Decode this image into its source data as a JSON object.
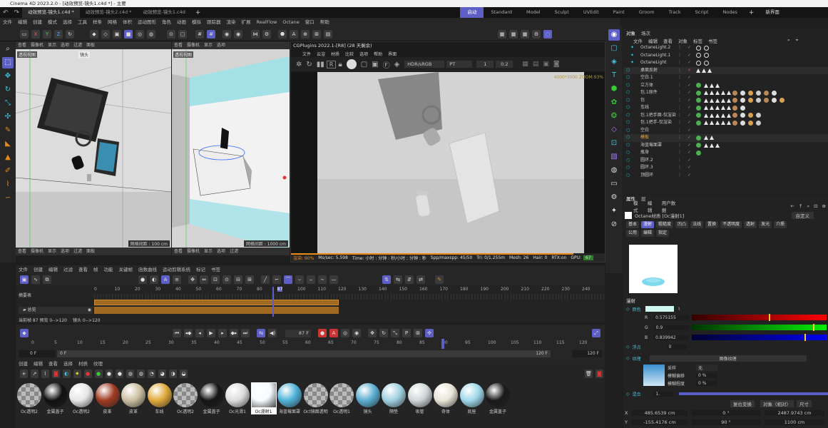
{
  "window": {
    "title": "Cinema 4D 2023.2.0 - [动效预览-镜头1.c4d *] - 主要"
  },
  "doc_tabs": [
    "动效预览-镜头1.c4d *",
    "动效预览-镜头2.c4d *",
    "动效预览-镜头1.c4d"
  ],
  "layouts": [
    "启动",
    "Standard",
    "Model",
    "Sculpt",
    "UVEdit",
    "Paint",
    "Groom",
    "Track",
    "Script",
    "Nodes"
  ],
  "new_layout": "新界面",
  "menu": [
    "文件",
    "编辑",
    "创建",
    "模式",
    "选择",
    "工具",
    "样条",
    "网格",
    "体积",
    "运动图形",
    "角色",
    "动画",
    "模拟",
    "跟踪器",
    "渲染",
    "扩展",
    "RealFlow",
    "Octane",
    "窗口",
    "帮助"
  ],
  "viewports": {
    "menu": [
      "查看",
      "摄像机",
      "显示",
      "选项",
      "过滤",
      "面板"
    ],
    "vp1": {
      "label": "透视视图",
      "camera": "镜头",
      "grid": "网格间距 : 100 cm"
    },
    "vp2": {
      "label": "透视视图",
      "grid": "网格间距 : 1000 cm"
    }
  },
  "octane": {
    "title": "CGPlugins  2022.1-[R8] (28 天剩余)",
    "menu": [
      "文件",
      "云渲",
      "材质",
      "比较",
      "选项",
      "帮助",
      "界面"
    ],
    "colorspace": "HDR/sRGB",
    "mode": "PT",
    "val1": "1",
    "val2": "0.2",
    "resolution": "4000*3000 ZOOM:93%",
    "status": {
      "progress": "渲染: 90%",
      "mssec": "Ms/sec: 5.598",
      "time": "Time: 小时 : 分钟 : 秒/小时 : 分钟 : 秒",
      "spp": "Spp/maxspp: 45/50",
      "tri": "Tri: 0/1.255m",
      "mesh": "Mesh: 26",
      "hair": "Hair: 0",
      "rtx": "RTX:on",
      "gpu": "GPU:",
      "gpuval": "67"
    },
    "progress": 0.9
  },
  "timeline": {
    "menu": [
      "文件",
      "创建",
      "编辑",
      "过滤",
      "查看",
      "帧",
      "功能",
      "关键帧",
      "函数曲线",
      "运动剪辑系统",
      "标记",
      "书签"
    ],
    "ticks": [
      "0",
      "10",
      "20",
      "30",
      "40",
      "50",
      "60",
      "70",
      "80",
      "87",
      "100",
      "110",
      "120",
      "130",
      "140",
      "150",
      "160",
      "170",
      "180",
      "190",
      "200",
      "210",
      "220",
      "230",
      "240"
    ],
    "summary": "摘要表",
    "track": "总览",
    "current": "当前帧  87  预览  0-->120",
    "current2": "镜头  0-->120"
  },
  "transport": {
    "frame": "87 F",
    "start": "0 F",
    "startb": "0 F",
    "end": "120 F",
    "endb": "120 F",
    "ticks": [
      "0",
      "5",
      "10",
      "15",
      "20",
      "25",
      "30",
      "35",
      "40",
      "45",
      "50",
      "55",
      "60",
      "65",
      "70",
      "75",
      "80",
      "85",
      "90",
      "95",
      "100",
      "105",
      "110",
      "115",
      "120"
    ]
  },
  "materials": {
    "menu": [
      "创建",
      "编辑",
      "查看",
      "选择",
      "材质",
      "纹理"
    ],
    "items": [
      {
        "name": "Oc透明2",
        "c": "check"
      },
      {
        "name": "金属盖子",
        "c": "#111"
      },
      {
        "name": "Oc透明2",
        "c": "#e6e6e6"
      },
      {
        "name": "皮革",
        "c": "#9e3a22"
      },
      {
        "name": "皮革",
        "c": "#cbbfa0"
      },
      {
        "name": "车线",
        "c": "#e0a93a"
      },
      {
        "name": "Oc透明2",
        "c": "check"
      },
      {
        "name": "金属盖子",
        "c": "#151515"
      },
      {
        "name": "Oc光滑1",
        "c": "#dcdcdc"
      },
      {
        "name": "Oc漫射1",
        "c": "#f4fbff"
      },
      {
        "name": "海蓝莓面罩",
        "c": "#4fb2d8"
      },
      {
        "name": "Oct镜面透明",
        "c": "check"
      },
      {
        "name": "Oc透明1",
        "c": "check"
      },
      {
        "name": "镜头",
        "c": "#5aaed0"
      },
      {
        "name": "隔垫",
        "c": "#9fd0e0"
      },
      {
        "name": "吸管",
        "c": "#cfd6d8"
      },
      {
        "name": "奇体",
        "c": "#e8e4d8"
      },
      {
        "name": "底座",
        "c": "#9ed8ea"
      },
      {
        "name": "金属盖子",
        "c": "#1a1a1a"
      }
    ]
  },
  "objects": {
    "tabs": [
      "对象",
      "场次"
    ],
    "menu": [
      "文件",
      "编辑",
      "查看",
      "对象",
      "标签",
      "书签"
    ],
    "rows": [
      "OctaneLight.2",
      "OctaneLight.1",
      "OctaneLight",
      "桌面反射",
      "空白.1",
      "立方体",
      "包.1原件",
      "包",
      "车线",
      "包.1把手面-仅渲染",
      "包.1把手-仅渲染",
      "空白",
      "模板",
      "海蓝莓面罩",
      "瓶身",
      "圆环.2",
      "圆环.3",
      "顶圆环"
    ]
  },
  "attributes": {
    "tabs": [
      "属性",
      "层"
    ],
    "menu": [
      "模式",
      "编辑",
      "用户数据"
    ],
    "material": "Octane材质 [Oc漫射1]",
    "custom": "自定义",
    "chips1": [
      "基本",
      "漫射",
      "粗糙度",
      "凹凸",
      "法线",
      "置换",
      "不透明度",
      "透射",
      "发光",
      "介质"
    ],
    "chips2": [
      "公用",
      "编辑",
      "指定"
    ],
    "section": "漫射",
    "color_label": "颜色",
    "r_label": "R",
    "r": "0.575155",
    "r_frac": 0.575,
    "g_label": "G",
    "g": "0.9",
    "g_frac": 0.9,
    "b_label": "B",
    "b": "0.839942",
    "b_frac": 0.84,
    "float_label": "浮点",
    "float": "0",
    "texture_label": "纹理",
    "texture": "图像纹理",
    "sample_label": "采样",
    "sample_val": "无",
    "blur_off_label": "模糊偏移",
    "blur_off": "0 %",
    "blur_deg_label": "模糊程度",
    "blur_deg": "0 %",
    "mix_label": "混合",
    "mix": "1."
  },
  "coords": {
    "reset": "复位变换",
    "obj": "对象（相对）",
    "size": "尺寸",
    "x_label": "X",
    "x1": "485.6539 cm",
    "x2": "0 °",
    "x3": "2487.9743 cm",
    "y_label": "Y",
    "y1": "-155.4176 cm",
    "y2": "90 °",
    "y3": "1100 cm"
  },
  "colors": {
    "accent": "#5d5fc7",
    "orange": "#e88a1a",
    "cyan": "#3ec7e0",
    "green": "#4caf50"
  }
}
